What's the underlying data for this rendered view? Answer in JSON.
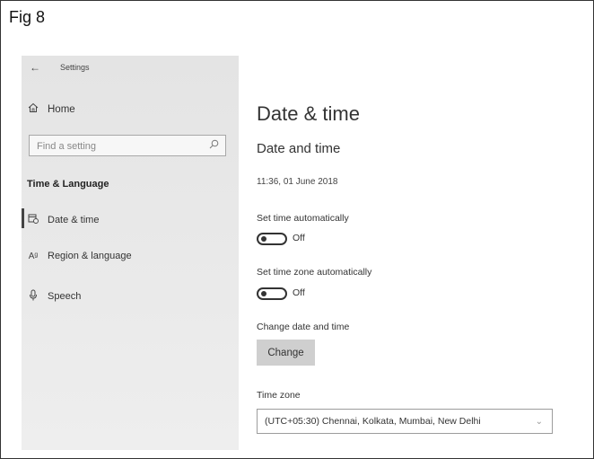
{
  "figure": {
    "label": "Fig 8"
  },
  "window": {
    "title": "Settings",
    "back_icon": "arrow-left-icon"
  },
  "sidebar": {
    "home": {
      "label": "Home",
      "icon": "home-icon"
    },
    "search": {
      "placeholder": "Find a setting",
      "icon": "search-icon"
    },
    "section_title": "Time & Language",
    "items": [
      {
        "label": "Date & time",
        "icon": "calendar-clock-icon",
        "selected": true
      },
      {
        "label": "Region & language",
        "icon": "language-icon",
        "selected": false
      },
      {
        "label": "Speech",
        "icon": "microphone-icon",
        "selected": false
      }
    ]
  },
  "main": {
    "page_title": "Date & time",
    "section_title": "Date and time",
    "current_datetime": "11:36, 01 June 2018",
    "set_time_auto": {
      "label": "Set time automatically",
      "state": "Off"
    },
    "set_timezone_auto": {
      "label": "Set time zone automatically",
      "state": "Off"
    },
    "change_date": {
      "label": "Change date and time",
      "button": "Change"
    },
    "time_zone": {
      "label": "Time zone",
      "value": "(UTC+05:30) Chennai, Kolkata, Mumbai, New Delhi"
    }
  }
}
